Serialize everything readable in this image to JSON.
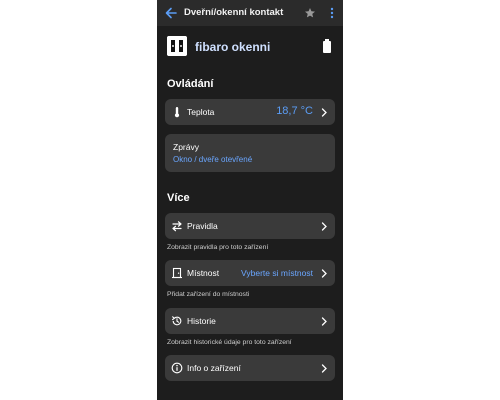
{
  "appbar": {
    "title": "Dveřní/okenní kontakt",
    "back_icon": "arrow-left-icon",
    "star_icon": "star-icon",
    "more_icon": "more-vertical-icon"
  },
  "device": {
    "name": "fibaro okenni",
    "icon": "door-window-sensor-icon",
    "battery_icon": "battery-full-icon"
  },
  "sections": {
    "control_title": "Ovládání",
    "more_title": "Více"
  },
  "temperature": {
    "label": "Teplota",
    "value": "18,7 °C",
    "icon": "thermometer-icon"
  },
  "messages": {
    "label": "Zprávy",
    "value": "Okno / dveře otevřené"
  },
  "items": [
    {
      "label": "Pravidla",
      "icon": "swap-arrows-icon",
      "value": "",
      "hint": "Zobrazit pravidla pro toto zařízení"
    },
    {
      "label": "Místnost",
      "icon": "door-icon",
      "value": "Vyberte si místnost",
      "hint": "Přidat zařízení do místnosti"
    },
    {
      "label": "Historie",
      "icon": "history-icon",
      "value": "",
      "hint": "Zobrazit historické údaje pro toto zařízení"
    },
    {
      "label": "Info o zařízení",
      "icon": "info-icon",
      "value": "",
      "hint": ""
    }
  ],
  "colors": {
    "accent": "#5b9df5",
    "background": "#1d1d1d",
    "card": "#3a3a3a",
    "appbar": "#2b2b2b"
  }
}
